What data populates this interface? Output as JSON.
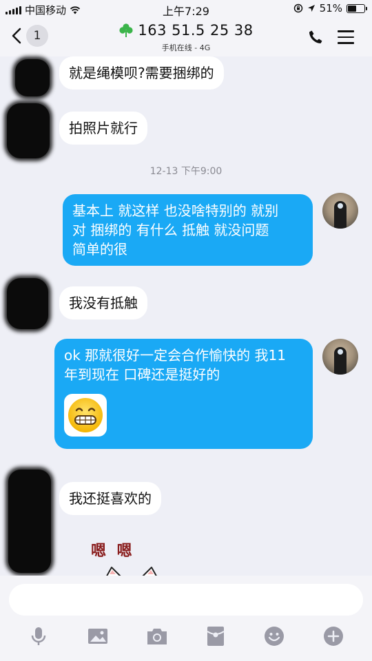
{
  "status_bar": {
    "carrier": "中国移动",
    "time": "上午7:29",
    "battery_percent_label": "51%",
    "battery_level": 0.51,
    "icons": [
      "signal-icon",
      "wifi-icon",
      "rotation-lock-icon",
      "location-icon",
      "battery-icon"
    ]
  },
  "header": {
    "back_badge": "1",
    "title": "163 51.5 25 38",
    "subtitle": "手机在线 - 4G",
    "icons": [
      "back-chevron-icon",
      "clover-icon",
      "phone-icon",
      "menu-icon"
    ]
  },
  "messages": [
    {
      "side": "in",
      "text": "就是绳模呗?需要捆绑的"
    },
    {
      "side": "in",
      "text": "拍照片就行"
    },
    {
      "side": "out",
      "lines": [
        "基本上 就这样 也没啥特别的 就别",
        "对 捆绑的 有什么 抵触 就没问题",
        "简单的很"
      ]
    },
    {
      "side": "in",
      "text": "我没有抵触"
    },
    {
      "side": "out",
      "lines": [
        "ok 那就很好一定会合作愉快的 我11",
        "年到现在 口碑还是挺好的"
      ],
      "emoji": "grinning-face-emoji"
    },
    {
      "side": "in",
      "text": "我还挺喜欢的"
    },
    {
      "side": "in",
      "sticker_text": "嗯 嗯"
    }
  ],
  "timestamp": "12-13 下午9:00",
  "input": {
    "value": "",
    "placeholder": ""
  },
  "toolbar": {
    "icons": [
      "microphone-icon",
      "image-icon",
      "camera-icon",
      "red-packet-icon",
      "emoji-icon",
      "plus-icon"
    ]
  },
  "colors": {
    "background": "#eeeff6",
    "bar": "#f4f4f8",
    "bubble_out": "#1aa9f5",
    "bubble_in": "#ffffff",
    "clover": "#3bb44a",
    "toolbar_icon": "#9a9aa6"
  }
}
